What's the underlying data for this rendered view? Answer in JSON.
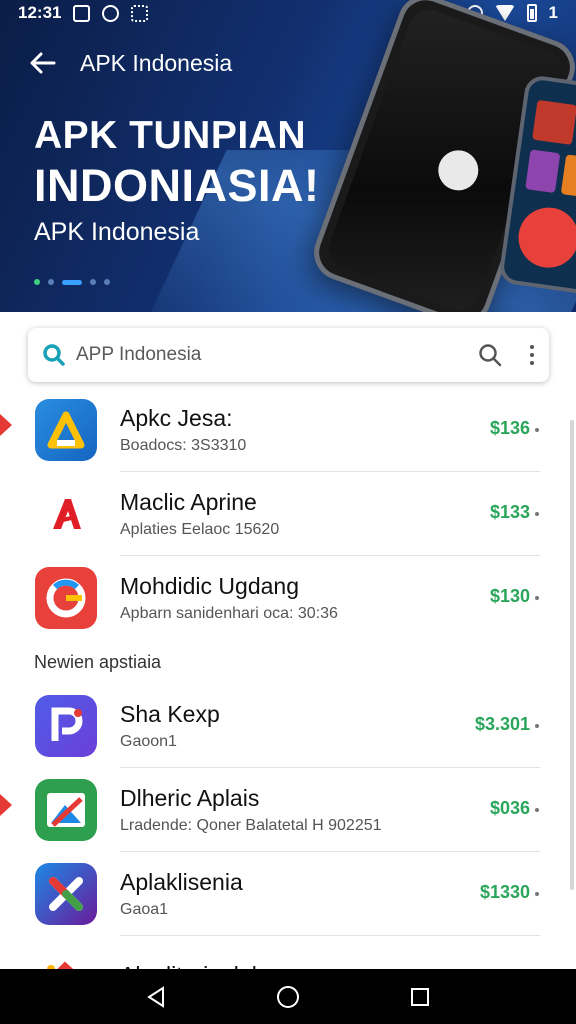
{
  "status_bar": {
    "time": "12:31",
    "battery_label": "1"
  },
  "header": {
    "title": "APK Indonesia"
  },
  "hero": {
    "headline_1": "APK TUNPIAN",
    "headline_2": "INDONIASIA!",
    "subtitle": "APK Indonesia",
    "carousel_pages": 5,
    "carousel_active": 3
  },
  "search": {
    "placeholder": "APP Indonesia"
  },
  "apps": [
    {
      "title": "Apkc Jesa:",
      "subtitle": "Boadocs: 3S3310",
      "price": "$136",
      "icon": "triangle-logo-icon",
      "marked": true
    },
    {
      "title": "Maclic Aprine",
      "subtitle": "Aplaties Eelaoc 15620",
      "price": "$133",
      "icon": "red-a-logo-icon",
      "marked": false
    },
    {
      "title": "Mohdidic Ugdang",
      "subtitle": "Apbarn sanidenhari oca: 30:36",
      "price": "$130",
      "icon": "swirl-logo-icon",
      "marked": false
    }
  ],
  "section": {
    "label": "Newien apstiaia"
  },
  "apps_2": [
    {
      "title": "Sha Kexp",
      "subtitle": "Gaoon1",
      "price": "$3.301",
      "icon": "p-logo-icon",
      "marked": false
    },
    {
      "title": "Dlheric Aplais",
      "subtitle": "Lradende: Qoner Balatetal H 902251",
      "price": "$036",
      "icon": "image-logo-icon",
      "marked": true
    },
    {
      "title": "Aplaklisenia",
      "subtitle": "Gaoa1",
      "price": "$1330",
      "icon": "x-logo-icon",
      "marked": false
    },
    {
      "title": "Alaplitorinalakese",
      "subtitle": "",
      "price": "",
      "icon": "red-logo-icon",
      "marked": false
    }
  ],
  "colors": {
    "accent_green": "#2aa65b",
    "hero_blue": "#123070",
    "marker_red": "#e53935"
  }
}
